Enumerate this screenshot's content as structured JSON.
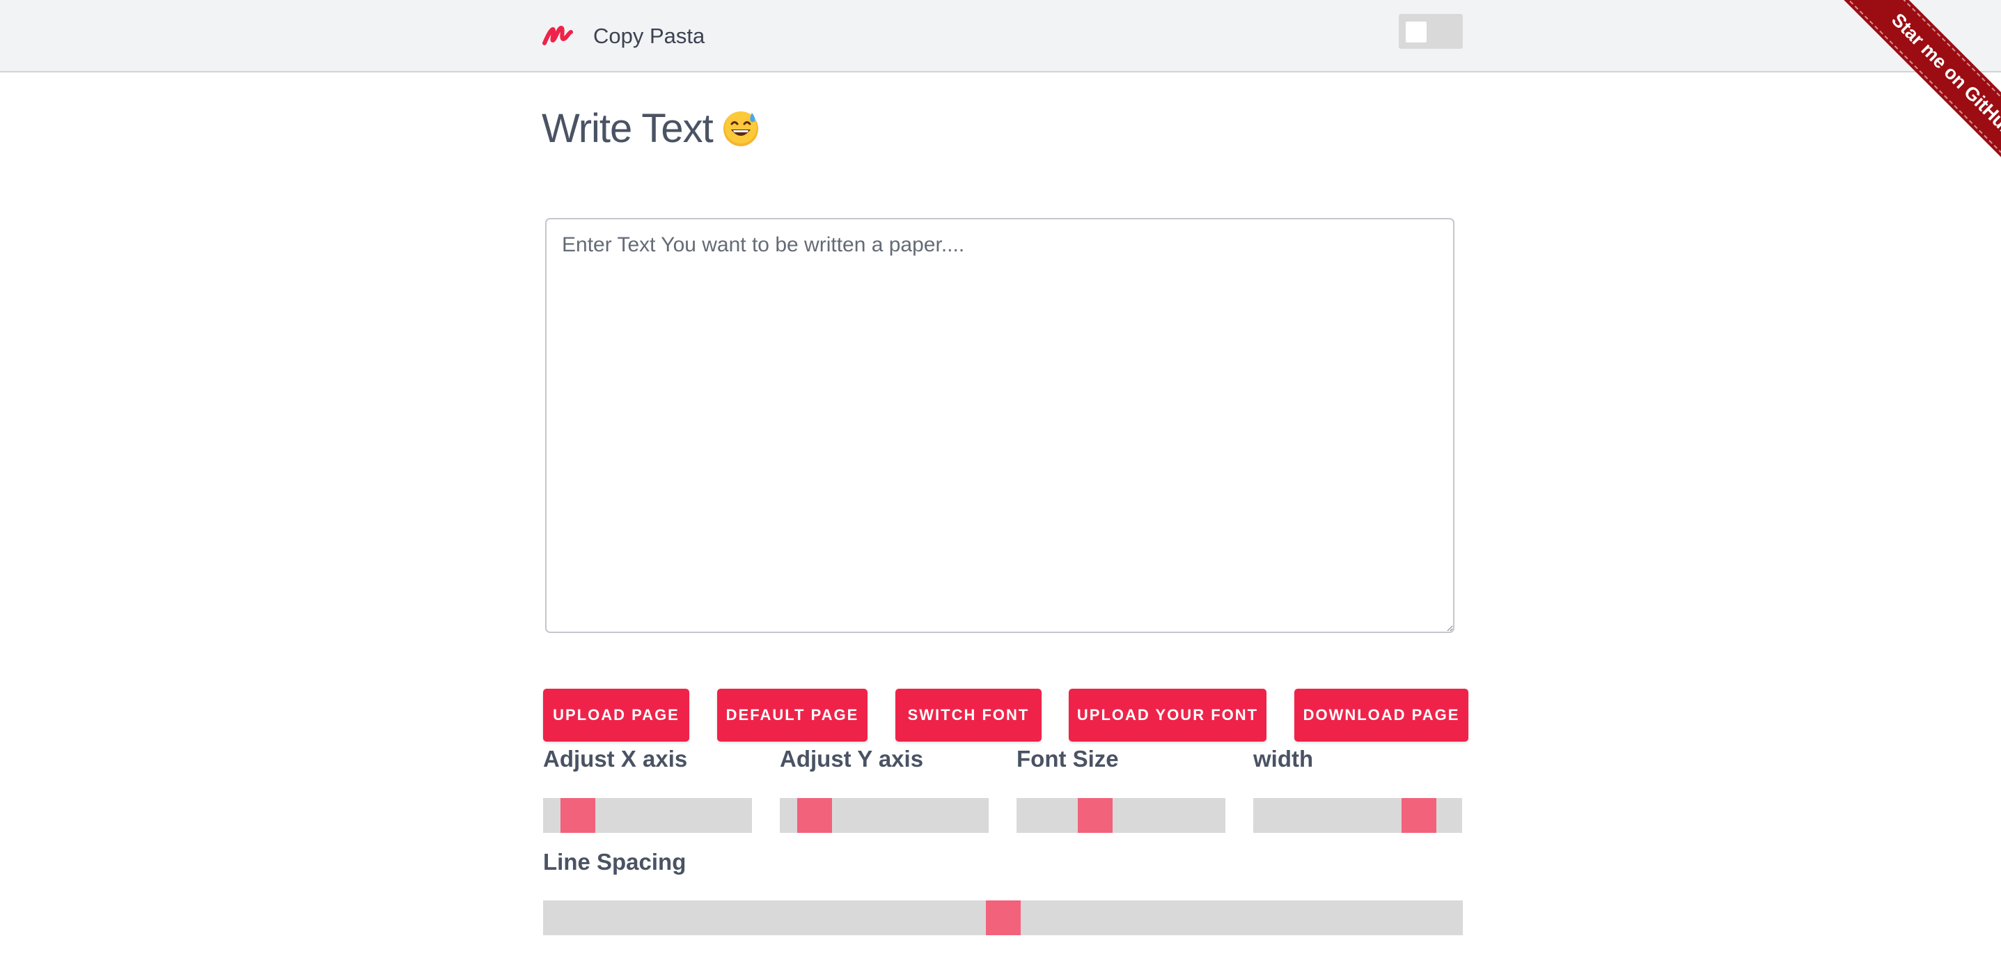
{
  "header": {
    "brand": "Copy Pasta",
    "logo_icon": "brand-scribble-icon",
    "dark_mode_toggle": {
      "on": false
    }
  },
  "ribbon": {
    "label": "Star me on GitHub"
  },
  "main": {
    "title": "Write Text",
    "title_emoji": "grinning-face-with-sweat-icon",
    "textarea": {
      "value": "",
      "placeholder": "Enter Text You want to be written a paper...."
    },
    "buttons": {
      "upload_page": "UPLOAD PAGE",
      "default_page": "DEFAULT PAGE",
      "switch_font": "SWITCH FONT",
      "upload_font": "UPLOAD YOUR FONT",
      "download_page": "DOWNLOAD PAGE"
    },
    "sliders": {
      "x_axis": {
        "label": "Adjust X axis",
        "value": 0.1
      },
      "y_axis": {
        "label": "Adjust Y axis",
        "value": 0.1
      },
      "font_size": {
        "label": "Font Size",
        "value": 0.35
      },
      "width": {
        "label": "width",
        "value": 0.85
      },
      "line_spacing": {
        "label": "Line Spacing",
        "value": 0.5
      }
    }
  },
  "colors": {
    "accent": "#ef2349",
    "slider_thumb": "#f2627b",
    "slider_track": "#d9d9d9",
    "ribbon": "#9b0d12",
    "header_bg": "#f2f3f5",
    "text": "#4a5363"
  }
}
